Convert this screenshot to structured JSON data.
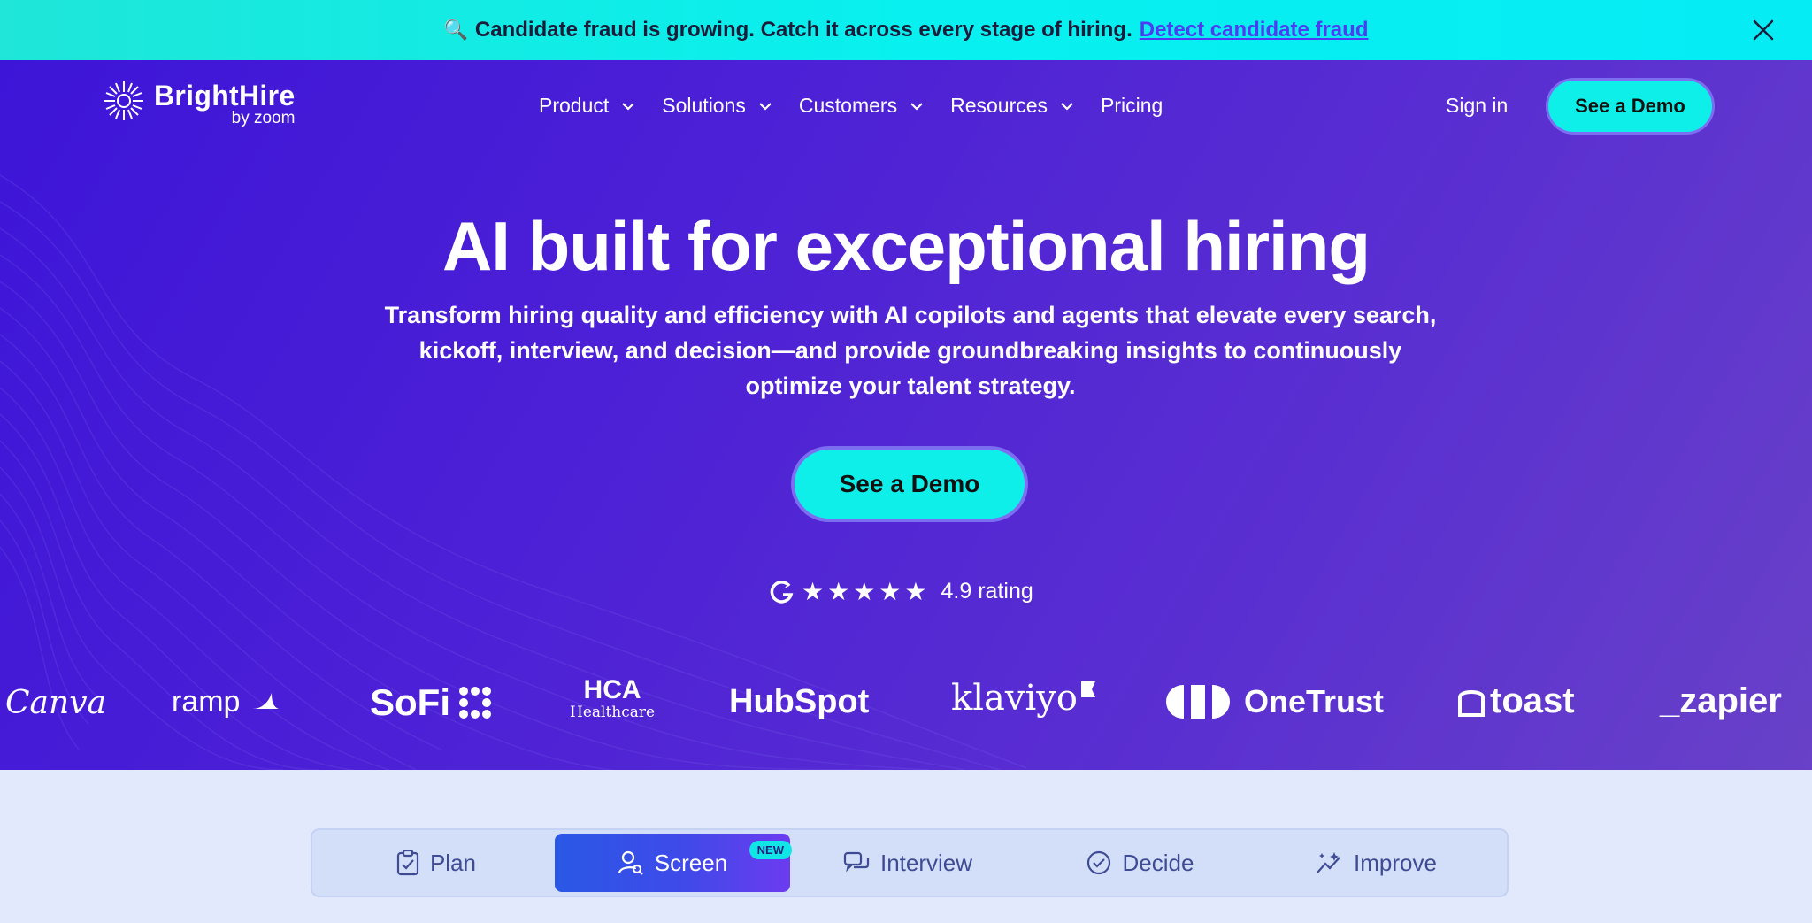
{
  "announcement": {
    "icon": "magnifier-icon",
    "text": "Candidate fraud is growing. Catch it across every stage of hiring.",
    "link": "Detect candidate fraud",
    "close_icon": "close-icon"
  },
  "brand": {
    "name": "BrightHire",
    "sub": "by zoom"
  },
  "nav": {
    "items": [
      "Product",
      "Solutions",
      "Customers",
      "Resources",
      "Pricing"
    ],
    "signin": "Sign in",
    "cta": "See a Demo"
  },
  "hero": {
    "headline": "AI built for exceptional hiring",
    "subtext": "Transform hiring quality and efficiency with AI copilots and agents that elevate every search, kickoff, interview, and decision—and provide groundbreaking insights to continuously optimize your talent strategy.",
    "cta": "See a Demo",
    "rating_stars": "★★★★★",
    "rating": "4.9 rating"
  },
  "logos": {
    "canva": "Canva",
    "ramp": "ramp",
    "sofi": "SoFi",
    "hca": "HCA",
    "hca_sub": "Healthcare",
    "hubspot": "HubSpot",
    "klaviyo": "klaviyo",
    "onetrust": "OneTrust",
    "toast": "toast",
    "zapier": "_zapier"
  },
  "tabs": {
    "items": [
      "Plan",
      "Screen",
      "Interview",
      "Decide",
      "Improve"
    ],
    "badge": "NEW",
    "active": "Screen"
  },
  "colors": {
    "accent": "#0fefe9",
    "hero_start": "#3d15d8",
    "hero_end": "#6841c8",
    "link": "#4f3cf2"
  }
}
